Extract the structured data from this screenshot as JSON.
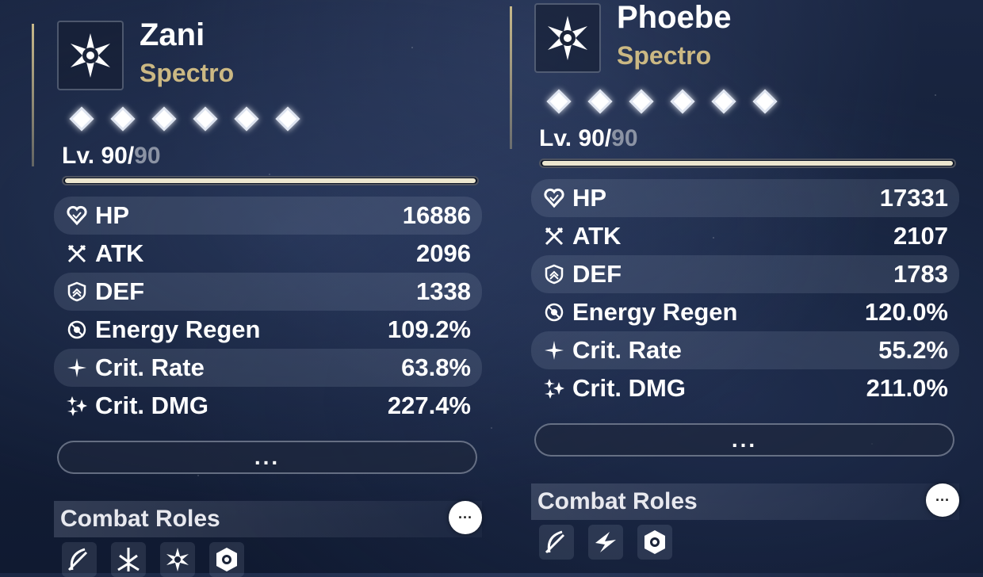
{
  "characters": [
    {
      "name": "Zani",
      "element": "Spectro",
      "level": {
        "current": "Lv. 90/",
        "max": "90",
        "progress": 1.0
      },
      "stats": [
        {
          "label": "HP",
          "value": "16886",
          "icon": "heart-icon"
        },
        {
          "label": "ATK",
          "value": "2096",
          "icon": "crossed-swords-icon"
        },
        {
          "label": "DEF",
          "value": "1338",
          "icon": "shield-icon"
        },
        {
          "label": "Energy Regen",
          "value": "109.2%",
          "icon": "energy-regen-icon"
        },
        {
          "label": "Crit. Rate",
          "value": "63.8%",
          "icon": "crit-rate-icon"
        },
        {
          "label": "Crit. DMG",
          "value": "227.4%",
          "icon": "crit-dmg-icon"
        }
      ],
      "more_label": "...",
      "combat_roles": {
        "title": "Combat Roles",
        "more": "···"
      }
    },
    {
      "name": "Phoebe",
      "element": "Spectro",
      "level": {
        "current": "Lv. 90/",
        "max": "90",
        "progress": 1.0
      },
      "stats": [
        {
          "label": "HP",
          "value": "17331",
          "icon": "heart-icon"
        },
        {
          "label": "ATK",
          "value": "2107",
          "icon": "crossed-swords-icon"
        },
        {
          "label": "DEF",
          "value": "1783",
          "icon": "shield-icon"
        },
        {
          "label": "Energy Regen",
          "value": "120.0%",
          "icon": "energy-regen-icon"
        },
        {
          "label": "Crit. Rate",
          "value": "55.2%",
          "icon": "crit-rate-icon"
        },
        {
          "label": "Crit. DMG",
          "value": "211.0%",
          "icon": "crit-dmg-icon"
        }
      ],
      "more_label": "...",
      "combat_roles": {
        "title": "Combat Roles",
        "more": "···"
      }
    }
  ]
}
